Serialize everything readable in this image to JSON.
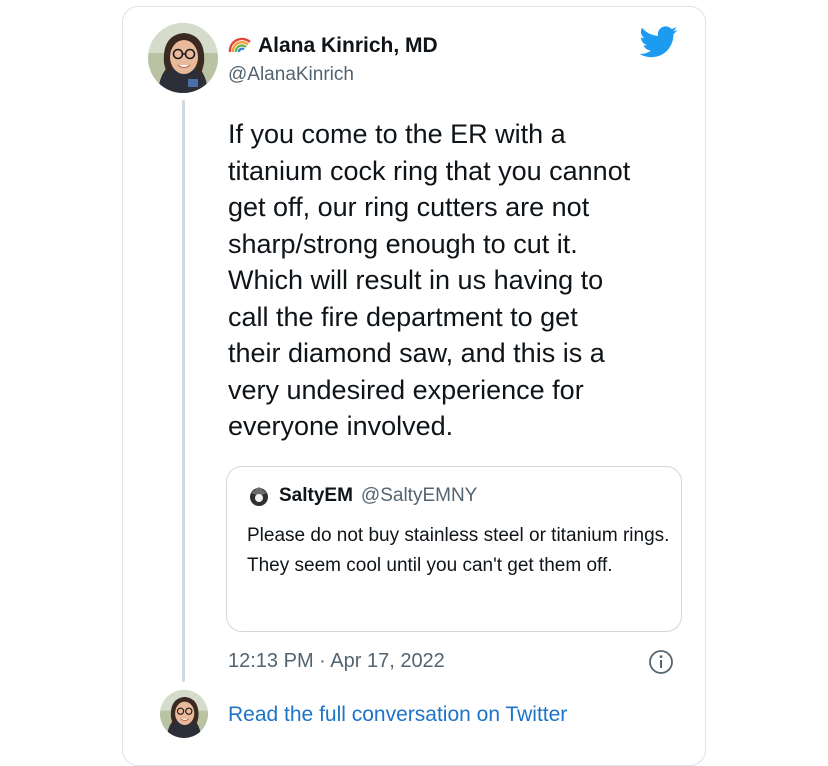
{
  "tweet": {
    "author_name": "Alana Kinrich, MD",
    "author_handle": "@AlanaKinrich",
    "text": "If you come to the ER with a\ntitanium cock ring that you cannot\nget off, our ring cutters are not\nsharp/strong enough to cut it.\nWhich will result in us having to\ncall the fire department to get\ntheir diamond saw, and this is a\nvery undesired experience for\neveryone involved.",
    "timestamp": "12:13 PM · Apr 17, 2022",
    "name_icon": "rainbow-icon",
    "logo_icon": "twitter-bird-icon"
  },
  "quoted_tweet": {
    "author_name": "SaltyEM",
    "author_handle": "@SaltyEMNY",
    "text": "Please do not buy stainless steel or titanium rings. They seem cool until you can't get them off."
  },
  "footer": {
    "link_text": "Read the full conversation on Twitter"
  },
  "colors": {
    "twitter_blue": "#1d9bf0",
    "link_blue": "#1d74c9",
    "secondary_text": "#536471",
    "border": "#cfd9de"
  }
}
